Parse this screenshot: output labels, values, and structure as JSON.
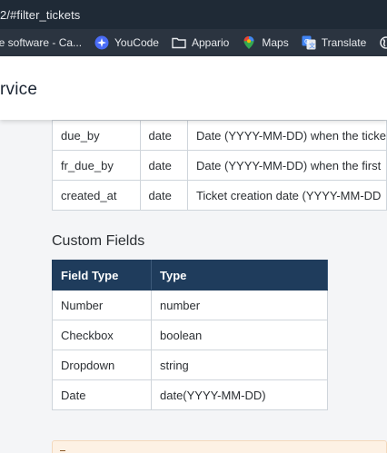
{
  "browser": {
    "url_fragment": "2/#filter_tickets",
    "bookmarks": [
      {
        "label": "le software - Ca...",
        "icon": "folder-icon"
      },
      {
        "label": "YouCode",
        "icon": "youcode-icon"
      },
      {
        "label": "Appario",
        "icon": "folder-icon"
      },
      {
        "label": "Maps",
        "icon": "maps-pin-icon"
      },
      {
        "label": "Translate",
        "icon": "translate-icon"
      },
      {
        "label": "",
        "icon": "globe-icon"
      },
      {
        "label": "",
        "icon": "slack-icon"
      }
    ]
  },
  "header": {
    "title": "rvice"
  },
  "fields_table": {
    "rows": [
      {
        "name": "due_by",
        "type": "date",
        "description": "Date (YYYY-MM-DD) when the ticke"
      },
      {
        "name": "fr_due_by",
        "type": "date",
        "description": "Date (YYYY-MM-DD) when the first"
      },
      {
        "name": "created_at",
        "type": "date",
        "description": "Ticket creation date (YYYY-MM-DD"
      }
    ]
  },
  "custom_fields": {
    "heading": "Custom Fields",
    "headers": [
      "Field Type",
      "Type"
    ],
    "rows": [
      [
        "Number",
        "number"
      ],
      [
        "Checkbox",
        "boolean"
      ],
      [
        "Dropdown",
        "string"
      ],
      [
        "Date",
        "date(YYYY-MM-DD)"
      ]
    ]
  },
  "colors": {
    "chrome_bg": "#1f2a36",
    "table_header_bg": "#1f3c5c",
    "note_bg": "#fdf1e4"
  }
}
